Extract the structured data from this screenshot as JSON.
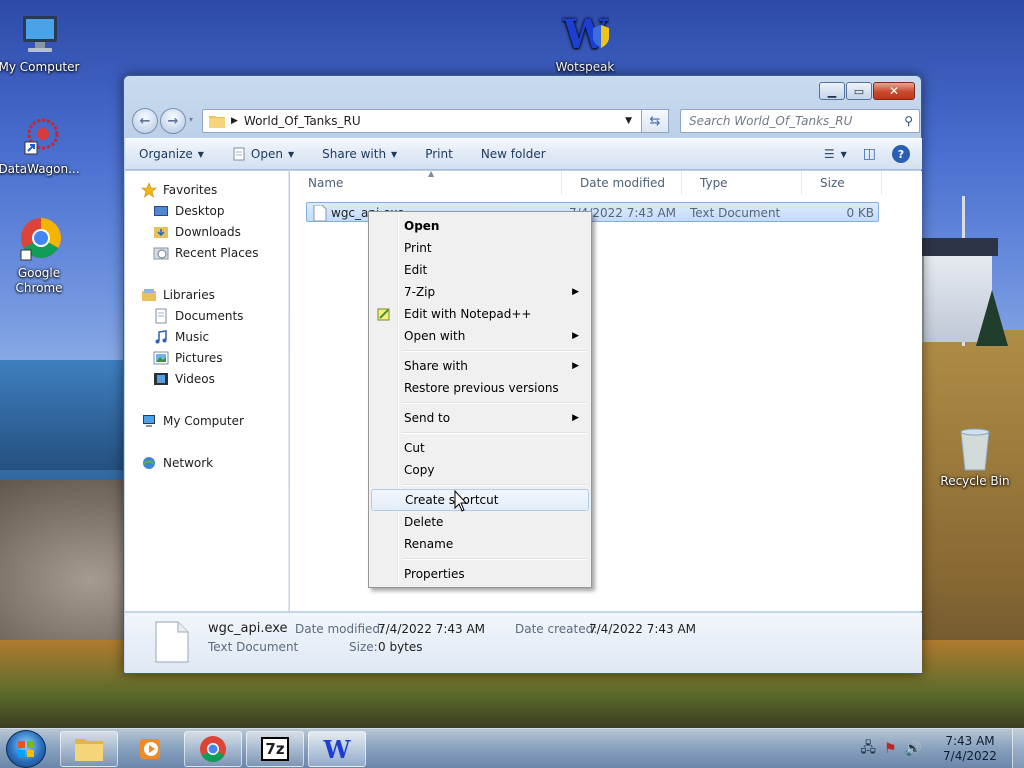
{
  "desktop": {
    "icons": [
      {
        "label": "My Computer"
      },
      {
        "label": "DataWagon..."
      },
      {
        "label": "Google Chrome"
      },
      {
        "label": "Wotspeak"
      },
      {
        "label": "Recycle Bin"
      }
    ]
  },
  "window": {
    "address": "World_Of_Tanks_RU",
    "search_placeholder": "Search World_Of_Tanks_RU",
    "toolbar": {
      "organize": "Organize",
      "open": "Open",
      "share_with": "Share with",
      "print": "Print",
      "new_folder": "New folder"
    },
    "nav": {
      "favorites": "Favorites",
      "desktop": "Desktop",
      "downloads": "Downloads",
      "recent_places": "Recent Places",
      "libraries": "Libraries",
      "documents": "Documents",
      "music": "Music",
      "pictures": "Pictures",
      "videos": "Videos",
      "my_computer": "My Computer",
      "network": "Network"
    },
    "columns": {
      "name": "Name",
      "date": "Date modified",
      "type": "Type",
      "size": "Size"
    },
    "file": {
      "name": "wgc_api.exe",
      "date": "7/4/2022 7:43 AM",
      "type": "Text Document",
      "size": "0 KB"
    },
    "details": {
      "name": "wgc_api.exe",
      "type": "Text Document",
      "date_modified_label": "Date modified:",
      "date_modified": "7/4/2022 7:43 AM",
      "date_created_label": "Date created:",
      "date_created": "7/4/2022 7:43 AM",
      "size_label": "Size:",
      "size": "0 bytes"
    }
  },
  "context_menu": {
    "open": "Open",
    "print": "Print",
    "edit": "Edit",
    "seven_zip": "7-Zip",
    "edit_notepad": "Edit with Notepad++",
    "open_with": "Open with",
    "share_with": "Share with",
    "restore": "Restore previous versions",
    "send_to": "Send to",
    "cut": "Cut",
    "copy": "Copy",
    "create_shortcut": "Create shortcut",
    "delete": "Delete",
    "rename": "Rename",
    "properties": "Properties"
  },
  "taskbar": {
    "seven_zip_label": "7z",
    "wotspeak_label": "W",
    "time": "7:43 AM",
    "date": "7/4/2022"
  }
}
